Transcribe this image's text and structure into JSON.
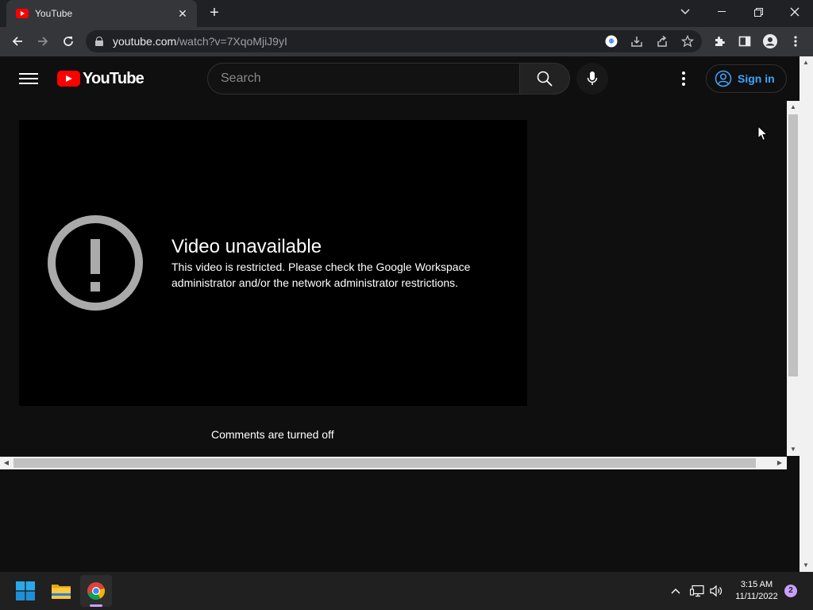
{
  "browser": {
    "tab_title": "YouTube",
    "tab_close": "✕",
    "new_tab": "+",
    "url_host": "youtube.com",
    "url_path": "/watch?v=7XqoMjiJ9yI"
  },
  "youtube": {
    "logo_text": "YouTube",
    "search_placeholder": "Search",
    "signin_label": "Sign in"
  },
  "player": {
    "error_title": "Video unavailable",
    "error_message": "This video is restricted. Please check the Google Workspace administrator and/or the network administrator restrictions."
  },
  "comments_status": "Comments are turned off",
  "taskbar": {
    "time": "3:15 AM",
    "date": "11/11/2022",
    "notification_count": "2"
  },
  "colors": {
    "youtube_red": "#ff0000",
    "signin_blue": "#3ea6ff",
    "background": "#0f0f0f"
  }
}
